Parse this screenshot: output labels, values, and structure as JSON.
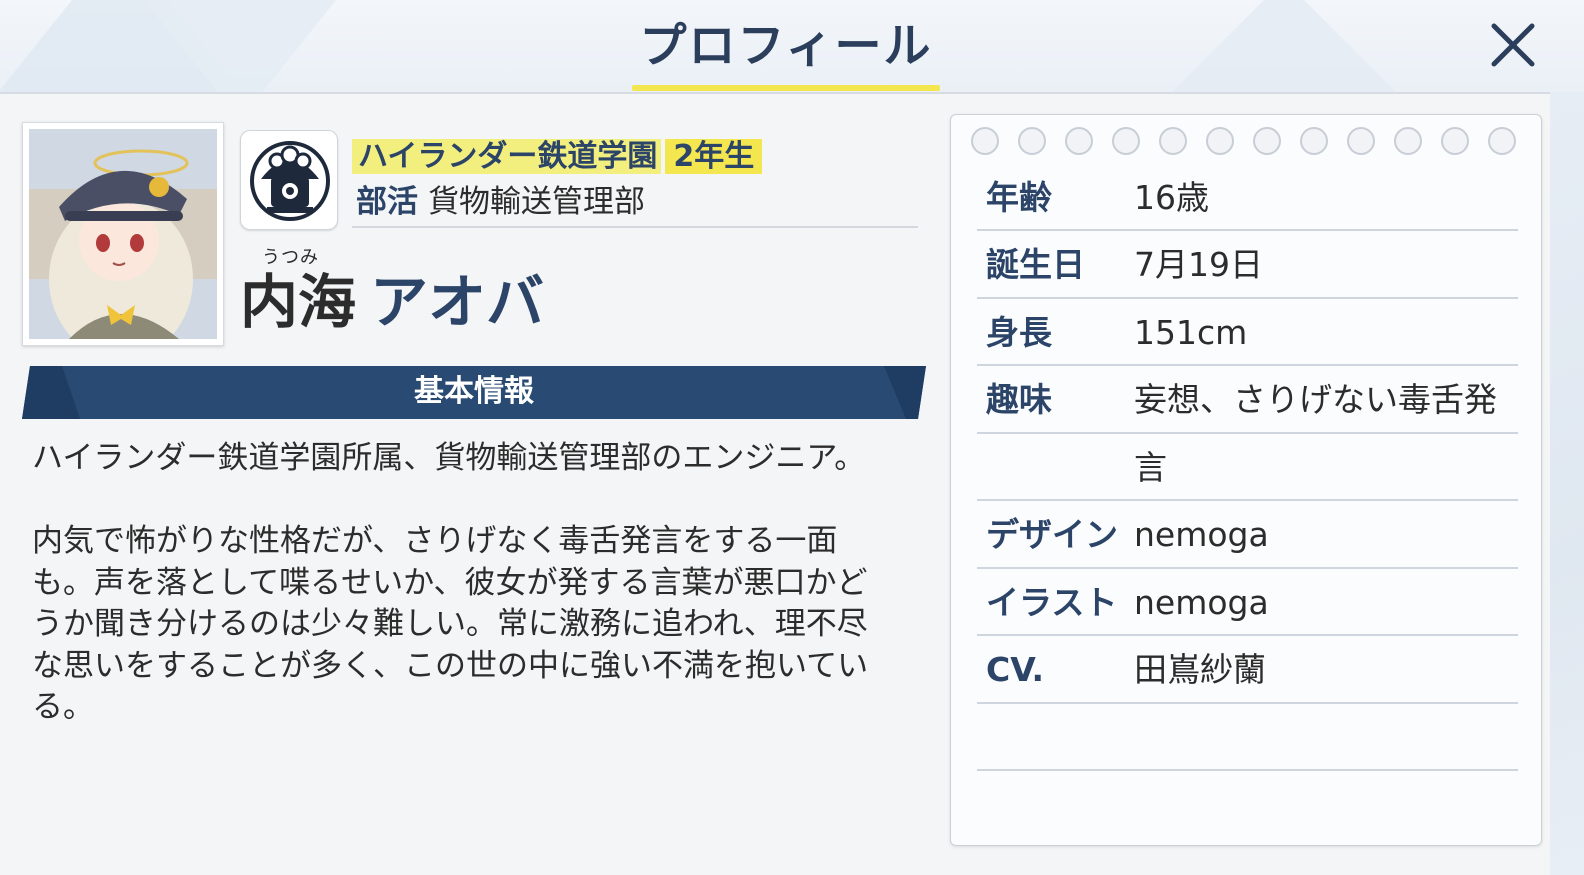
{
  "header": {
    "title": "プロフィール"
  },
  "icons": {
    "close": "close-icon",
    "emblem": "locomotive-emblem-icon"
  },
  "colors": {
    "navy": "#2b4468",
    "highlight_yellow": "#f3e64f",
    "banner_blue": "#284a73"
  },
  "student": {
    "school": "ハイランダー鉄道学園",
    "grade": "2年生",
    "club_label": "部活",
    "club": "貨物輸送管理部",
    "family_ruby": "うつみ",
    "family_name": "内海",
    "given_name": "アオバ"
  },
  "section": {
    "title": "基本情報"
  },
  "description": "ハイランダー鉄道学園所属、貨物輸送管理部のエンジニア。\n\n内気で怖がりな性格だが、さりげなく毒舌発言をする一面\nも。声を落として喋るせいか、彼女が発する言葉が悪口かど\nうか聞き分けるのは少々難しい。常に激務に追われ、理不尽\nな思いをすることが多く、この世の中に強い不満を抱いてい\nる。",
  "profile": {
    "age_label": "年齢",
    "age": "16歳",
    "birthday_label": "誕生日",
    "birthday": "7月19日",
    "height_label": "身長",
    "height": "151cm",
    "hobby_label": "趣味",
    "hobby_line1": "妄想、さりげない毒舌発",
    "hobby_line2": "言",
    "design_label": "デザイン",
    "design": "nemoga",
    "illust_label": "イラスト",
    "illust": "nemoga",
    "cv_label": "CV.",
    "cv": "田嶌紗蘭"
  }
}
